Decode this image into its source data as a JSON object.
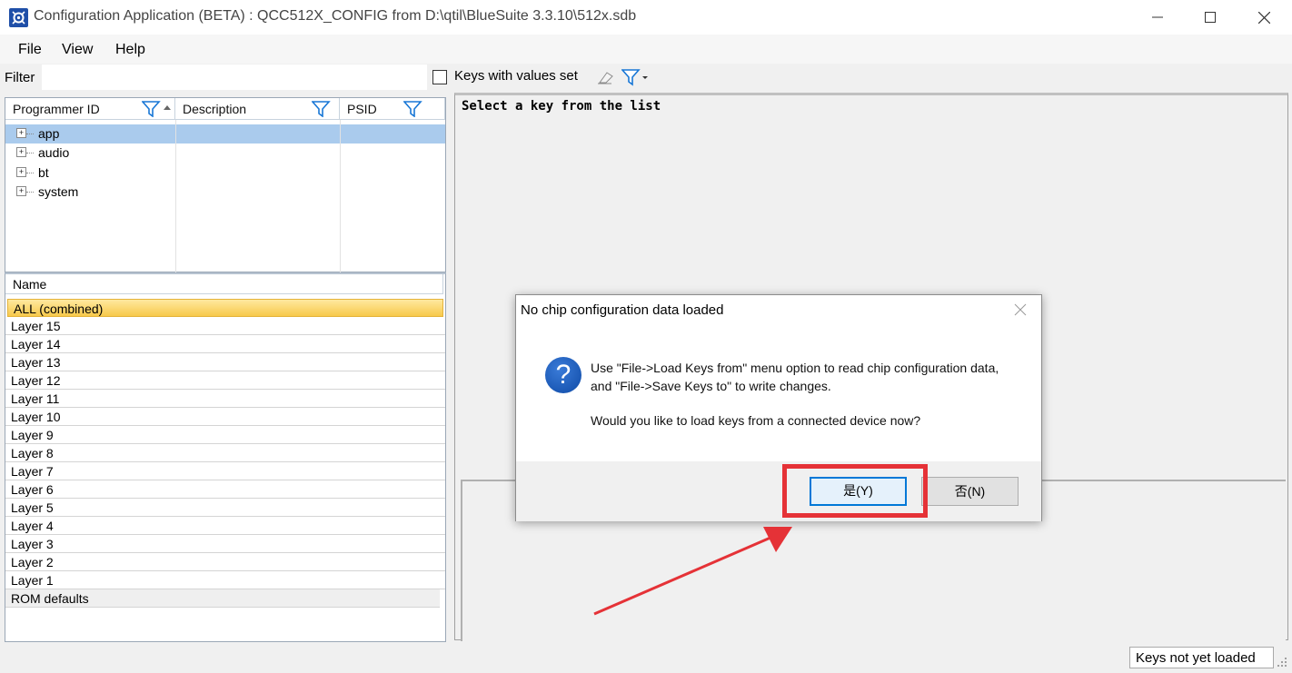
{
  "window": {
    "title": "Configuration Application (BETA) : QCC512X_CONFIG from D:\\qtil\\BlueSuite 3.3.10\\512x.sdb",
    "controls": [
      "minimize-icon",
      "maximize-icon",
      "close-icon"
    ]
  },
  "menu": {
    "items": [
      "File",
      "View",
      "Help"
    ]
  },
  "filter": {
    "label": "Filter",
    "value": "",
    "keys_with_values_label": "Keys with values set",
    "keys_with_values_checked": false
  },
  "tree": {
    "columns": [
      "Programmer ID",
      "Description",
      "PSID"
    ],
    "rows": [
      {
        "label": "app",
        "selected": true
      },
      {
        "label": "audio",
        "selected": false
      },
      {
        "label": "bt",
        "selected": false
      },
      {
        "label": "system",
        "selected": false
      }
    ]
  },
  "layers": {
    "header": "Name",
    "rows": [
      "ALL (combined)",
      "Layer 15",
      "Layer 14",
      "Layer 13",
      "Layer 12",
      "Layer 11",
      "Layer 10",
      "Layer 9",
      "Layer 8",
      "Layer 7",
      "Layer 6",
      "Layer 5",
      "Layer 4",
      "Layer 3",
      "Layer 2",
      "Layer 1",
      "ROM defaults"
    ]
  },
  "detail": {
    "placeholder": "Select a key from the list"
  },
  "status": {
    "text": "Keys not yet loaded"
  },
  "dialog": {
    "title": "No chip configuration data loaded",
    "message_line1": "Use \"File->Load Keys from\" menu option to read chip configuration data, and \"File->Save Keys to\" to write changes.",
    "message_line2": "Would you like to load keys from a connected device now?",
    "yes_label": "是(Y)",
    "no_label": "否(N)"
  },
  "colors": {
    "accent": "#0078d7",
    "selection": "#aacbed",
    "annotation": "#e53237",
    "all_row": "#f7c94b"
  }
}
